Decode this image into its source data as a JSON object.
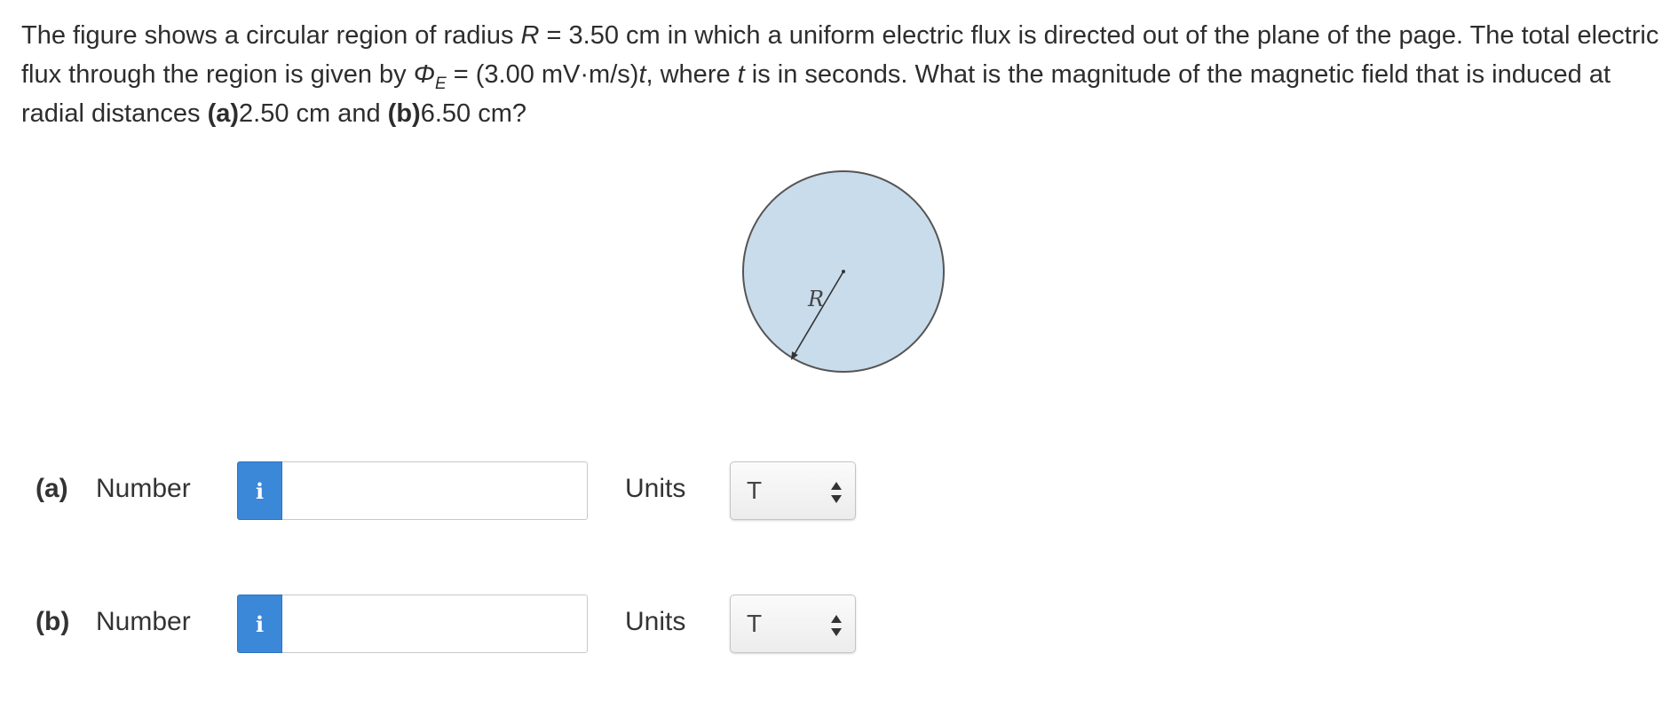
{
  "question": {
    "t1": "The figure shows a circular region of radius ",
    "R_sym": "R",
    "t2": " = 3.50 cm in which a uniform electric flux is directed out of the plane of the page. The total electric flux through the region is given by ",
    "phi_sym": "Φ",
    "phi_sub": "E",
    "t3": " = (3.00 mV·m/s)",
    "t_sym": "t",
    "t4": ", where ",
    "t_sym2": "t",
    "t5": " is in seconds. What is the magnitude of the magnetic field that is induced at radial distances ",
    "a_label": "(a)",
    "a_value": "2.50 cm and ",
    "b_label": "(b)",
    "b_value": "6.50 cm?"
  },
  "figure": {
    "radius_label": "R",
    "fill_color": "#c9dceb",
    "stroke_color": "#555555"
  },
  "parts": [
    {
      "part_label": "(a)",
      "number_label": "Number",
      "info_icon": "i",
      "value": "",
      "units_label": "Units",
      "units_value": "T"
    },
    {
      "part_label": "(b)",
      "number_label": "Number",
      "info_icon": "i",
      "value": "",
      "units_label": "Units",
      "units_value": "T"
    }
  ],
  "colors": {
    "info_button": "#3b87d8"
  }
}
